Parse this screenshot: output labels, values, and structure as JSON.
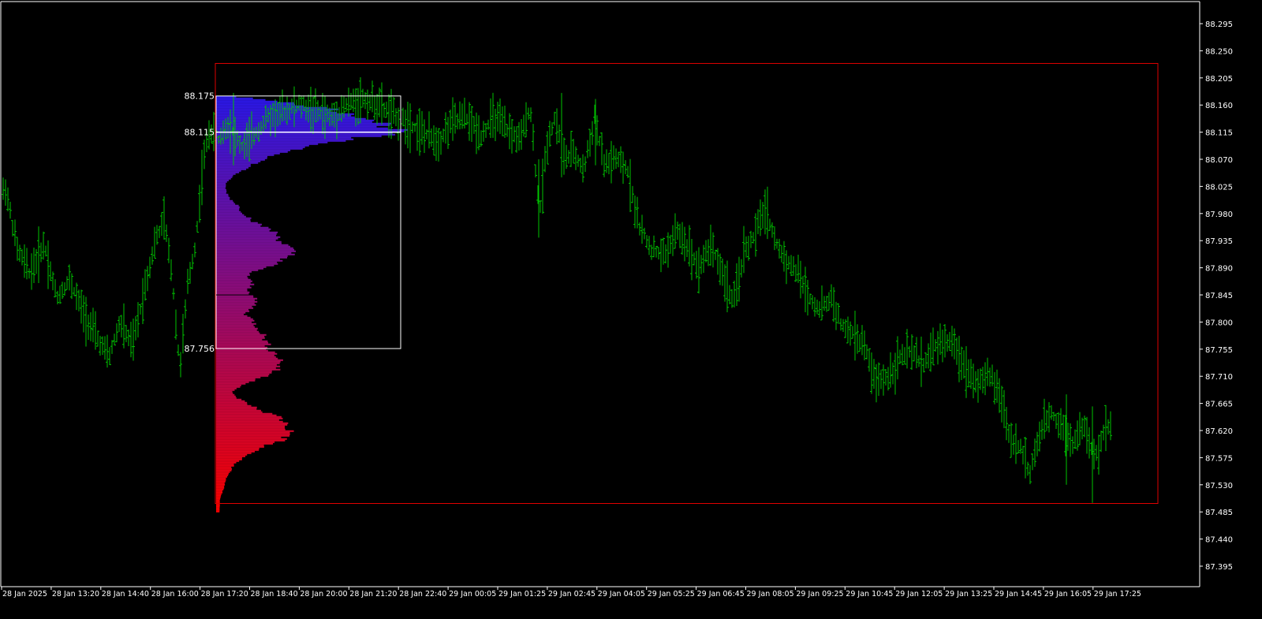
{
  "colors": {
    "background": "#000000",
    "axis": "#ffffff",
    "bars": "#00c400",
    "rect_range": "#e00000",
    "value_area_box": "#ffffff",
    "profile_high": "#1a1aff",
    "profile_low": "#ff0000"
  },
  "chart_data": {
    "type": "ohlc-bar",
    "grid": false,
    "y_axis": {
      "range": [
        87.35,
        88.33
      ],
      "tick_labels": [
        "88.295",
        "88.250",
        "88.205",
        "88.160",
        "88.115",
        "88.070",
        "88.025",
        "87.980",
        "87.935",
        "87.890",
        "87.845",
        "87.800",
        "87.755",
        "87.710",
        "87.665",
        "87.620",
        "87.575",
        "87.530",
        "87.485",
        "87.440",
        "87.395"
      ]
    },
    "x_axis": {
      "tick_labels": [
        "28 Jan 2025",
        "28 Jan 13:20",
        "28 Jan 14:40",
        "28 Jan 16:00",
        "28 Jan 17:20",
        "28 Jan 18:40",
        "28 Jan 20:00",
        "28 Jan 21:20",
        "28 Jan 22:40",
        "29 Jan 00:05",
        "29 Jan 01:25",
        "29 Jan 02:45",
        "29 Jan 04:05",
        "29 Jan 05:25",
        "29 Jan 06:45",
        "29 Jan 08:05",
        "29 Jan 09:25",
        "29 Jan 10:45",
        "29 Jan 12:05",
        "29 Jan 13:25",
        "29 Jan 14:45",
        "29 Jan 16:05",
        "29 Jan 17:25"
      ]
    },
    "price_path": [
      [
        0,
        87.99
      ],
      [
        6,
        88.03
      ],
      [
        22,
        87.92
      ],
      [
        38,
        87.88
      ],
      [
        56,
        87.93
      ],
      [
        72,
        87.84
      ],
      [
        88,
        87.87
      ],
      [
        104,
        87.82
      ],
      [
        120,
        87.78
      ],
      [
        138,
        87.74
      ],
      [
        152,
        87.8
      ],
      [
        168,
        87.76
      ],
      [
        184,
        87.86
      ],
      [
        196,
        87.93
      ],
      [
        208,
        87.97
      ],
      [
        218,
        87.88
      ],
      [
        228,
        87.72
      ],
      [
        238,
        87.86
      ],
      [
        248,
        87.93
      ],
      [
        258,
        88.07
      ],
      [
        266,
        88.12
      ],
      [
        276,
        88.1
      ],
      [
        290,
        88.13
      ],
      [
        306,
        88.09
      ],
      [
        322,
        88.11
      ],
      [
        340,
        88.14
      ],
      [
        360,
        88.15
      ],
      [
        380,
        88.16
      ],
      [
        400,
        88.15
      ],
      [
        420,
        88.14
      ],
      [
        440,
        88.16
      ],
      [
        460,
        88.17
      ],
      [
        480,
        88.16
      ],
      [
        500,
        88.14
      ],
      [
        520,
        88.13
      ],
      [
        540,
        88.11
      ],
      [
        556,
        88.1
      ],
      [
        572,
        88.13
      ],
      [
        590,
        88.14
      ],
      [
        610,
        88.11
      ],
      [
        626,
        88.14
      ],
      [
        642,
        88.12
      ],
      [
        660,
        88.1
      ],
      [
        672,
        88.16
      ],
      [
        684,
        87.98
      ],
      [
        694,
        88.1
      ],
      [
        704,
        88.14
      ],
      [
        716,
        88.07
      ],
      [
        728,
        88.08
      ],
      [
        740,
        88.05
      ],
      [
        754,
        88.14
      ],
      [
        766,
        88.06
      ],
      [
        780,
        88.07
      ],
      [
        796,
        88.05
      ],
      [
        810,
        87.96
      ],
      [
        826,
        87.92
      ],
      [
        842,
        87.91
      ],
      [
        858,
        87.95
      ],
      [
        870,
        87.93
      ],
      [
        886,
        87.89
      ],
      [
        902,
        87.93
      ],
      [
        916,
        87.88
      ],
      [
        930,
        87.83
      ],
      [
        944,
        87.92
      ],
      [
        956,
        87.94
      ],
      [
        970,
        87.99
      ],
      [
        984,
        87.93
      ],
      [
        998,
        87.9
      ],
      [
        1012,
        87.88
      ],
      [
        1026,
        87.84
      ],
      [
        1040,
        87.82
      ],
      [
        1054,
        87.84
      ],
      [
        1068,
        87.79
      ],
      [
        1082,
        87.78
      ],
      [
        1096,
        87.76
      ],
      [
        1110,
        87.7
      ],
      [
        1126,
        87.71
      ],
      [
        1140,
        87.74
      ],
      [
        1156,
        87.75
      ],
      [
        1170,
        87.73
      ],
      [
        1186,
        87.76
      ],
      [
        1202,
        87.77
      ],
      [
        1214,
        87.75
      ],
      [
        1226,
        87.72
      ],
      [
        1240,
        87.7
      ],
      [
        1256,
        87.71
      ],
      [
        1268,
        87.68
      ],
      [
        1280,
        87.61
      ],
      [
        1294,
        87.59
      ],
      [
        1306,
        87.55
      ],
      [
        1318,
        87.61
      ],
      [
        1332,
        87.65
      ],
      [
        1346,
        87.63
      ],
      [
        1360,
        87.6
      ],
      [
        1374,
        87.63
      ],
      [
        1388,
        87.57
      ],
      [
        1400,
        87.62
      ],
      [
        1410,
        87.63
      ]
    ],
    "range_rect": {
      "time_from": "28 Jan 17:20",
      "price_top": 88.229,
      "price_bottom": 87.499
    },
    "volume_profile": {
      "value_area_high": 88.175,
      "point_of_control": 88.115,
      "value_area_low": 87.756,
      "value_area_label_high": "88.175",
      "value_area_label_poc": "88.115",
      "value_area_label_low": "87.756",
      "levels": [
        [
          88.175,
          0.12
        ],
        [
          88.165,
          0.4
        ],
        [
          88.155,
          0.62
        ],
        [
          88.145,
          0.78
        ],
        [
          88.135,
          0.88
        ],
        [
          88.125,
          0.96
        ],
        [
          88.115,
          1.0
        ],
        [
          88.105,
          0.72
        ],
        [
          88.095,
          0.55
        ],
        [
          88.085,
          0.42
        ],
        [
          88.075,
          0.3
        ],
        [
          88.065,
          0.22
        ],
        [
          88.055,
          0.16
        ],
        [
          88.045,
          0.1
        ],
        [
          88.035,
          0.06
        ],
        [
          88.025,
          0.05
        ],
        [
          88.015,
          0.06
        ],
        [
          88.005,
          0.08
        ],
        [
          87.995,
          0.12
        ],
        [
          87.985,
          0.14
        ],
        [
          87.975,
          0.18
        ],
        [
          87.965,
          0.22
        ],
        [
          87.955,
          0.3
        ],
        [
          87.945,
          0.34
        ],
        [
          87.935,
          0.36
        ],
        [
          87.925,
          0.4
        ],
        [
          87.915,
          0.42
        ],
        [
          87.905,
          0.38
        ],
        [
          87.895,
          0.3
        ],
        [
          87.885,
          0.2
        ],
        [
          87.875,
          0.17
        ],
        [
          87.865,
          0.2
        ],
        [
          87.855,
          0.18
        ],
        [
          87.845,
          0.2
        ],
        [
          87.835,
          0.22
        ],
        [
          87.825,
          0.2
        ],
        [
          87.815,
          0.16
        ],
        [
          87.805,
          0.2
        ],
        [
          87.795,
          0.22
        ],
        [
          87.785,
          0.25
        ],
        [
          87.775,
          0.27
        ],
        [
          87.765,
          0.28
        ],
        [
          87.755,
          0.3
        ],
        [
          87.745,
          0.34
        ],
        [
          87.735,
          0.36
        ],
        [
          87.725,
          0.34
        ],
        [
          87.715,
          0.3
        ],
        [
          87.705,
          0.22
        ],
        [
          87.695,
          0.14
        ],
        [
          87.685,
          0.08
        ],
        [
          87.675,
          0.12
        ],
        [
          87.665,
          0.18
        ],
        [
          87.655,
          0.24
        ],
        [
          87.645,
          0.34
        ],
        [
          87.635,
          0.38
        ],
        [
          87.625,
          0.4
        ],
        [
          87.615,
          0.41
        ],
        [
          87.605,
          0.36
        ],
        [
          87.595,
          0.26
        ],
        [
          87.585,
          0.2
        ],
        [
          87.575,
          0.14
        ],
        [
          87.565,
          0.1
        ],
        [
          87.555,
          0.08
        ],
        [
          87.545,
          0.06
        ],
        [
          87.535,
          0.05
        ],
        [
          87.525,
          0.04
        ],
        [
          87.515,
          0.03
        ],
        [
          87.505,
          0.02
        ]
      ]
    }
  }
}
